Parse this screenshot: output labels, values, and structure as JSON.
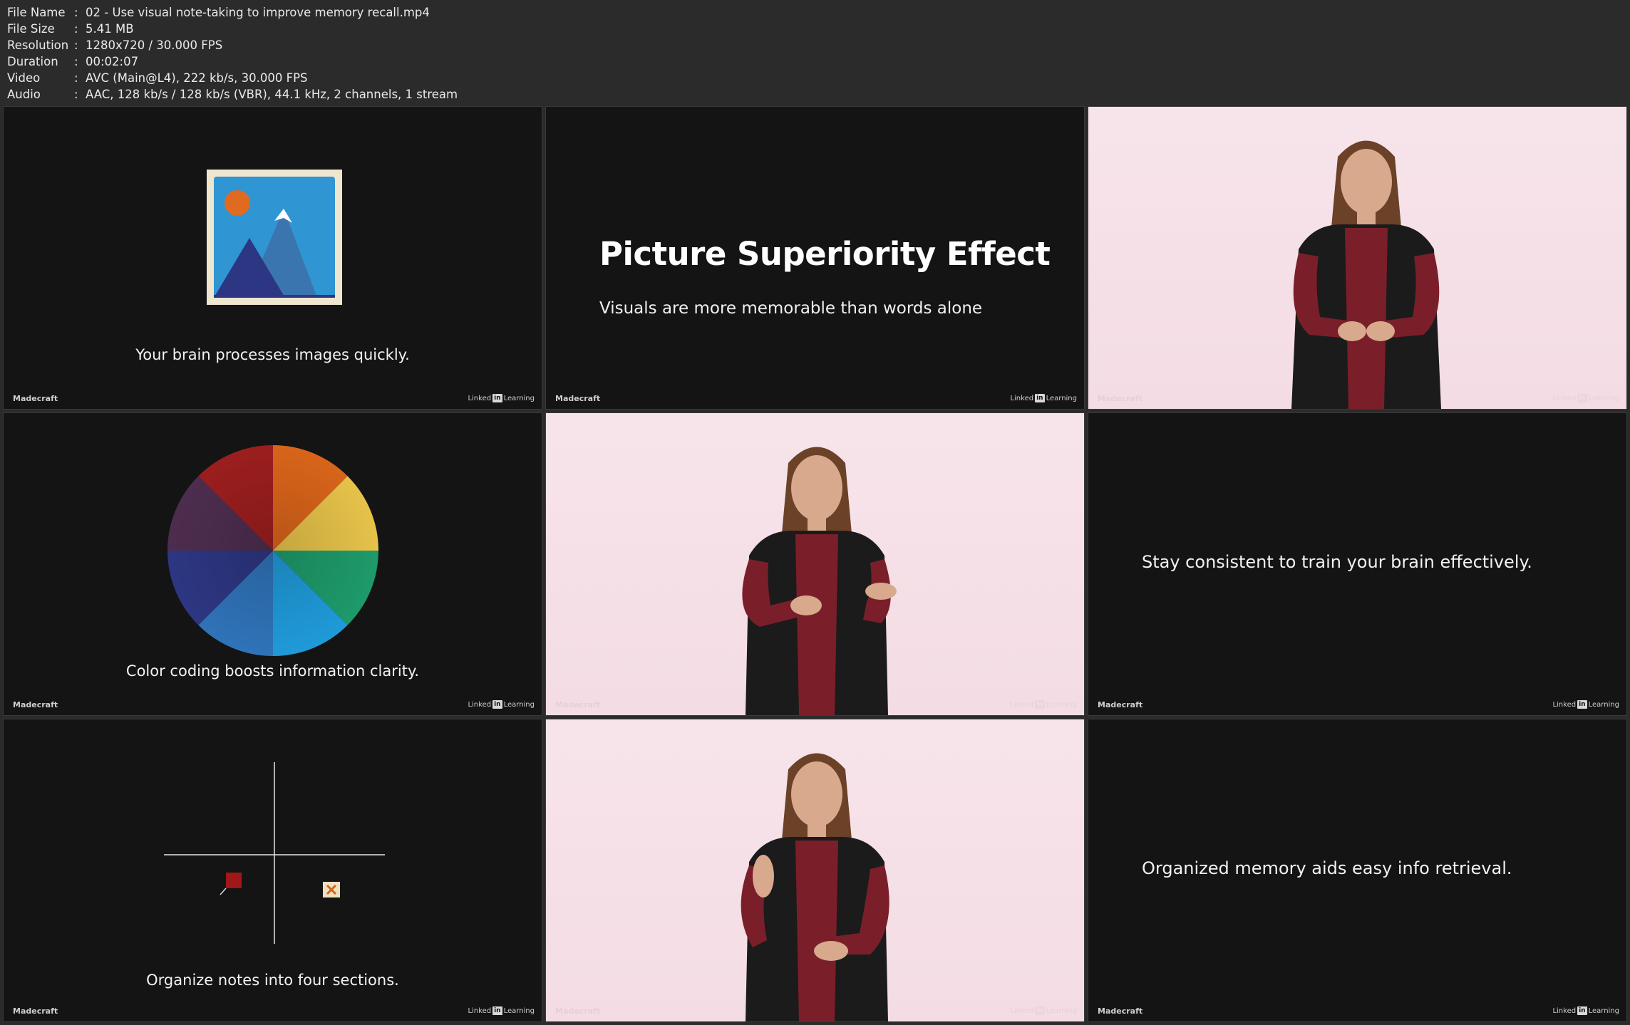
{
  "meta": {
    "rows": [
      {
        "key": "File Name",
        "value": "02 - Use visual note-taking to improve memory recall.mp4"
      },
      {
        "key": "File Size",
        "value": "5.41 MB"
      },
      {
        "key": "Resolution",
        "value": "1280x720 / 30.000 FPS"
      },
      {
        "key": "Duration",
        "value": "00:02:07"
      },
      {
        "key": "Video",
        "value": "AVC (Main@L4), 222 kb/s, 30.000 FPS"
      },
      {
        "key": "Audio",
        "value": "AAC, 128 kb/s / 128 kb/s (VBR), 44.1 kHz, 2 channels, 1 stream"
      }
    ],
    "separator": ":"
  },
  "brand": {
    "left": "Madecraft",
    "linked": "Linked",
    "in": "in",
    "learning": "Learning"
  },
  "tiles": {
    "t1": {
      "caption": "Your brain processes images quickly."
    },
    "t2": {
      "title": "Picture Superiority Effect",
      "subtitle": "Visuals are more memorable than words alone"
    },
    "t4": {
      "caption": "Color coding boosts information clarity."
    },
    "t6": {
      "caption": "Stay consistent to train your brain effectively."
    },
    "t7": {
      "caption": "Organize notes into four sections."
    },
    "t9": {
      "caption": "Organized memory aids easy info retrieval."
    }
  },
  "colors": {
    "tile_dark": "#141414",
    "tile_pink": "#f5dfe6",
    "shirt": "#7a1f2a",
    "vest": "#1b1b1b"
  }
}
